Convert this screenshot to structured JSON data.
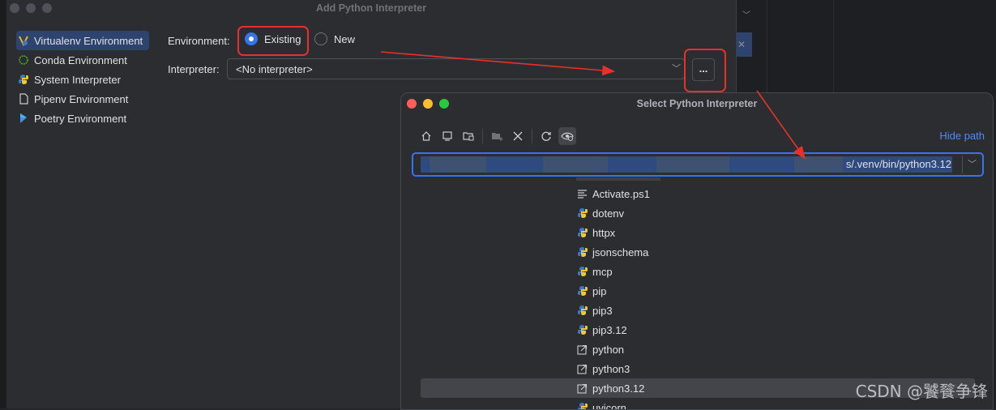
{
  "dialog": {
    "title": "Add Python Interpreter",
    "sidebar": [
      {
        "label": "Virtualenv Environment",
        "icon": "virtualenv-icon",
        "selected": true
      },
      {
        "label": "Conda Environment",
        "icon": "conda-icon",
        "selected": false
      },
      {
        "label": "System Interpreter",
        "icon": "python-icon",
        "selected": false
      },
      {
        "label": "Pipenv Environment",
        "icon": "pipenv-icon",
        "selected": false
      },
      {
        "label": "Poetry Environment",
        "icon": "poetry-icon",
        "selected": false
      }
    ],
    "environment_label": "Environment:",
    "existing_label": "Existing",
    "new_label": "New",
    "interpreter_label": "Interpreter:",
    "interpreter_value": "<No interpreter>",
    "browse_label": "..."
  },
  "chooser": {
    "title": "Select Python Interpreter",
    "hide_path_label": "Hide path",
    "path_value": "s/.venv/bin/python3.12",
    "toolbar_icons": [
      "home-icon",
      "desktop-icon",
      "project-folder-icon",
      "new-folder-icon",
      "delete-icon",
      "refresh-icon",
      "show-hidden-icon"
    ],
    "files": [
      {
        "name": "Activate.ps1",
        "icon": "text-file-icon",
        "selected": false
      },
      {
        "name": "dotenv",
        "icon": "python-file-icon",
        "selected": false
      },
      {
        "name": "httpx",
        "icon": "python-file-icon",
        "selected": false
      },
      {
        "name": "jsonschema",
        "icon": "python-file-icon",
        "selected": false
      },
      {
        "name": "mcp",
        "icon": "python-file-icon",
        "selected": false
      },
      {
        "name": "pip",
        "icon": "python-file-icon",
        "selected": false
      },
      {
        "name": "pip3",
        "icon": "python-file-icon",
        "selected": false
      },
      {
        "name": "pip3.12",
        "icon": "python-file-icon",
        "selected": false
      },
      {
        "name": "python",
        "icon": "symlink-icon",
        "selected": false
      },
      {
        "name": "python3",
        "icon": "symlink-icon",
        "selected": false
      },
      {
        "name": "python3.12",
        "icon": "symlink-icon",
        "selected": true
      },
      {
        "name": "uvicorn",
        "icon": "python-file-icon",
        "selected": false
      }
    ]
  },
  "watermark": "CSDN @饕餮争锋",
  "colors": {
    "accent": "#3574f0",
    "highlight": "#e8302b",
    "selection": "#2e436e",
    "link": "#548af7"
  }
}
